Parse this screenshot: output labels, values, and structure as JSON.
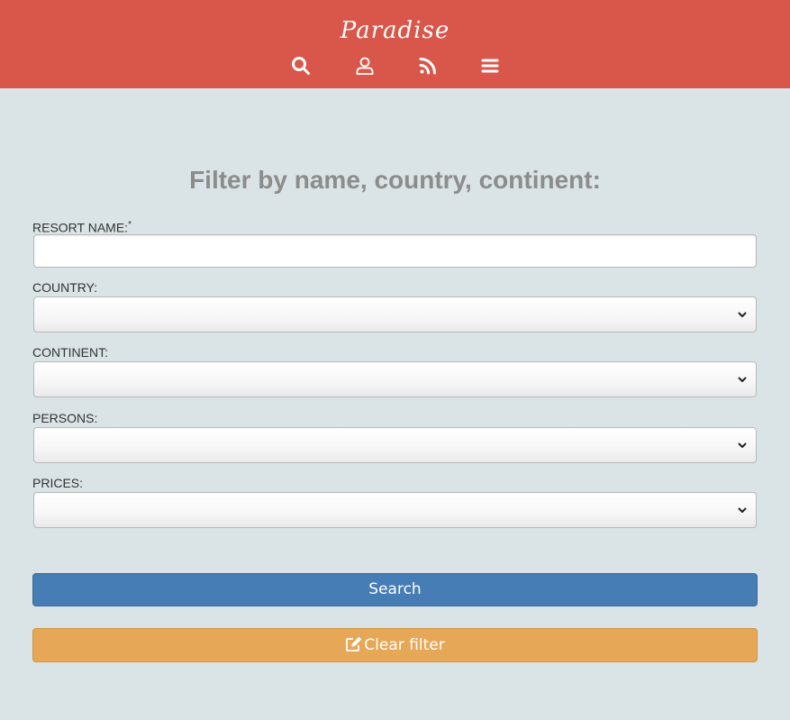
{
  "header": {
    "brand": "Paradise",
    "icons": [
      "search-icon",
      "user-icon",
      "rss-icon",
      "menu-icon"
    ],
    "background_color": "#d9574a"
  },
  "main": {
    "heading": "Filter by name, country, continent:"
  },
  "form": {
    "resort_name": {
      "label": "RESORT NAME:",
      "required_marker": "*",
      "value": "",
      "placeholder": ""
    },
    "country": {
      "label": "COUNTRY:",
      "selected": ""
    },
    "continent": {
      "label": "CONTINENT:",
      "selected": ""
    },
    "persons": {
      "label": "PERSONS:",
      "selected": ""
    },
    "prices": {
      "label": "PRICES:",
      "selected": ""
    }
  },
  "buttons": {
    "search": {
      "label": "Search",
      "color": "#467db5"
    },
    "clear": {
      "label": "Clear filter",
      "icon": "edit-icon",
      "color": "#e6a857"
    }
  },
  "page": {
    "background_color": "#dae3e6"
  }
}
